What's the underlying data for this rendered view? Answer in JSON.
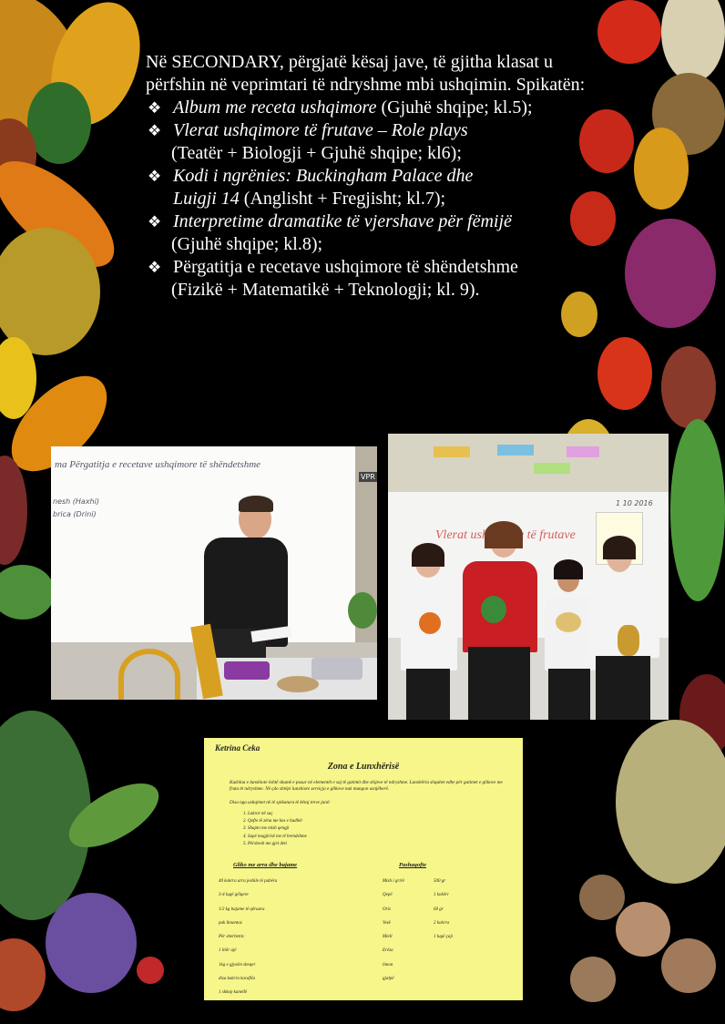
{
  "intro": "Në SECONDARY, përgjatë kësaj jave, të gjitha klasat u përfshin në veprimtari të ndryshme mbi ushqimin.  Spikatën:",
  "activities": [
    {
      "title": "Album me receta ushqimore",
      "detail": " (Gjuhë shqipe; kl.5);"
    },
    {
      "title": "Vlerat ushqimore të frutave – Role plays",
      "detail": "(Teatër + Biologji + Gjuhë shqipe; kl6);"
    },
    {
      "title": "Kodi i ngrënies: Buckingham Palace dhe",
      "title2": "Luigji 14",
      "detail": " (Anglisht + Fregjisht; kl.7);"
    },
    {
      "title": "Interpretime  dramatike të vjershave për fëmijë",
      "detail": "(Gjuhë shqipe; kl.8);"
    },
    {
      "title": "Përgatitja e recetave ushqimore të shëndetshme",
      "detail": "(Fizikë + Matematikë + Teknologji; kl. 9)."
    }
  ],
  "photo1": {
    "whiteboard_text": "ma   Përgatitja e recetave ushqimore të shëndetshme",
    "side_names": [
      "nesh (Haxhi)",
      "brica (Drini)"
    ],
    "corner_label": "VPR"
  },
  "photo2": {
    "whiteboard_text": "Vlerat ushqimore të frutave",
    "date": "1 10 2016"
  },
  "document": {
    "author": "Ketrina Ceka",
    "title": "Zona e Lunxhërisë",
    "paragraph": "Kuzhina e lunxhiote është shumë e pasur në elementët e saj të gatimit dhe shijeve të ndryshme. Lunxhëria  shquhet edhe për gatimet e gliko​ve me fruta  të ndryshme. Në çdo shtëpi lunxhiote serviçja e gliko​ve nuk mungon asnjëherë.",
    "paragraph2": "Disa nga ushqimet në të spikatura të këtaj treve janë:",
    "items": [
      "Lakror në saç",
      "Qofte të zëna me kos e hudhër",
      "Shapto me mish qengji",
      "Supë magjirisë me të brendshme",
      "Përshesh me gjel deti"
    ],
    "heading1": "Gliko me arra dhe bajame",
    "heading2": "Pashaqofte",
    "col1": [
      "40 kokrra arra jeshile të pabëra",
      "3-4 lugë gëlqere",
      "1/2 kg bajame të qëruara",
      "pak limontoz",
      "Për sherbetin:",
      "1 litër ujë",
      "1kg e gjysëm sheqer",
      "disa kokrra karafila",
      "1 shkop kanellë"
    ],
    "col2": [
      "Mish i grirë",
      "Qepë",
      "Oriz",
      "Vezë",
      "Miell",
      "Erëza",
      "limon",
      "gjalpë"
    ],
    "col3": [
      "500 gr",
      "1 kokërr",
      "60 gr",
      "2 kokrra",
      "1 lugë çaji"
    ]
  },
  "colors": {
    "background": "#000000",
    "text": "#ffffff",
    "doc_bg": "#f6f68a"
  }
}
